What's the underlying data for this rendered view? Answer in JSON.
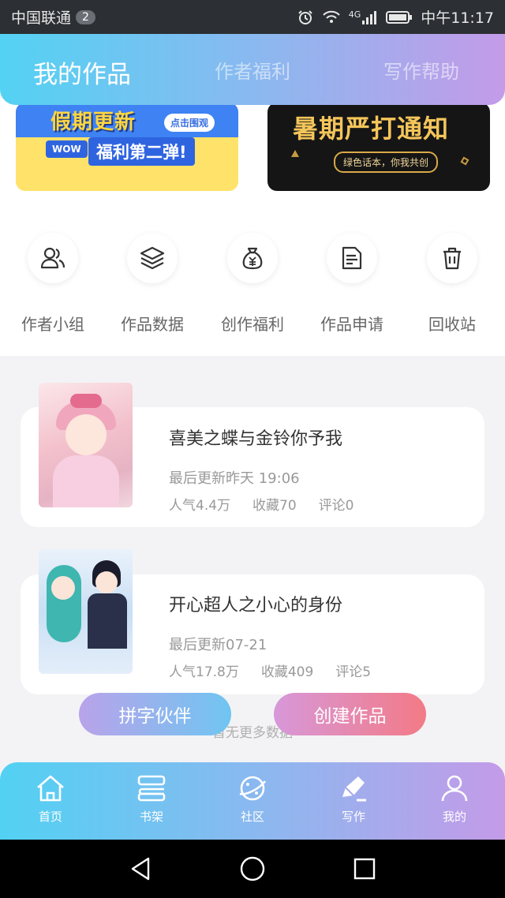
{
  "status_bar": {
    "carrier": "中国联通",
    "badge": "2",
    "network": "4G",
    "time": "中午11:17"
  },
  "header": {
    "tabs": [
      {
        "label": "我的作品",
        "active": true
      },
      {
        "label": "作者福利",
        "active": false
      },
      {
        "label": "写作帮助",
        "active": false
      }
    ]
  },
  "banners": [
    {
      "title": "假期更新",
      "tag": "点击围观",
      "badge": "WOW",
      "subtitle": "福利第二弹!"
    },
    {
      "title": "暑期严打通知",
      "subtitle": "绿色话本，你我共创"
    }
  ],
  "features": [
    {
      "label": "作者小组",
      "icon": "users-icon"
    },
    {
      "label": "作品数据",
      "icon": "layers-icon"
    },
    {
      "label": "创作福利",
      "icon": "money-bag-icon"
    },
    {
      "label": "作品申请",
      "icon": "document-icon"
    },
    {
      "label": "回收站",
      "icon": "trash-icon"
    }
  ],
  "works": [
    {
      "title": "喜美之蝶与金铃你予我",
      "last_update": "最后更新昨天 19:06",
      "popularity": "人气4.4万",
      "favorites": "收藏70",
      "comments": "评论0"
    },
    {
      "title": "开心超人之小心的身份",
      "last_update": "最后更新07-21",
      "popularity": "人气17.8万",
      "favorites": "收藏409",
      "comments": "评论5"
    }
  ],
  "no_more": "暂无更多数据",
  "actions": {
    "partner": "拼字伙伴",
    "create": "创建作品"
  },
  "tabbar": [
    {
      "label": "首页",
      "icon": "home-icon"
    },
    {
      "label": "书架",
      "icon": "bookshelf-icon"
    },
    {
      "label": "社区",
      "icon": "planet-icon"
    },
    {
      "label": "写作",
      "icon": "pen-icon",
      "active": true
    },
    {
      "label": "我的",
      "icon": "profile-icon"
    }
  ],
  "colors": {
    "gradient_start": "#53d2f3",
    "gradient_end": "#c49be8",
    "partner_start": "#b9a3ea",
    "create_end": "#f37a86"
  }
}
